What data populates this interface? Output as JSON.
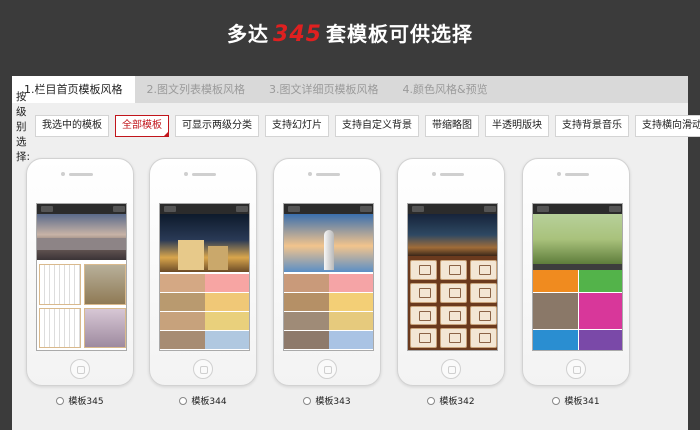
{
  "headline": {
    "prefix": "多达",
    "count": "345",
    "suffix": "套模板可供选择"
  },
  "tabs": [
    {
      "label": "1.栏目首页模板风格",
      "active": true
    },
    {
      "label": "2.图文列表模板风格",
      "active": false
    },
    {
      "label": "3.图文详细页模板风格",
      "active": false
    },
    {
      "label": "4.颜色风格&预览",
      "active": false
    }
  ],
  "filter": {
    "label": "按级别选择:",
    "buttons": [
      {
        "label": "我选中的模板",
        "active": false
      },
      {
        "label": "全部模板",
        "active": true
      },
      {
        "label": "可显示两级分类",
        "active": false
      },
      {
        "label": "支持幻灯片",
        "active": false
      },
      {
        "label": "支持自定义背景",
        "active": false
      },
      {
        "label": "带缩略图",
        "active": false
      },
      {
        "label": "半透明版块",
        "active": false
      },
      {
        "label": "支持背景音乐",
        "active": false
      },
      {
        "label": "支持横向滑动",
        "active": false
      }
    ]
  },
  "templates": [
    {
      "label": "模板345"
    },
    {
      "label": "模板344"
    },
    {
      "label": "模板343"
    },
    {
      "label": "模板342"
    },
    {
      "label": "模板341"
    }
  ],
  "colors": {
    "page_bg": "#3b3b3b",
    "accent": "#c1151b",
    "headline_number": "#e02020",
    "panel_bg": "#efefef",
    "tabbar_bg": "#d9d9d9"
  },
  "icons": {
    "checkmark": "checkmark-icon",
    "radio": "radio-icon",
    "home": "home-button-icon"
  }
}
